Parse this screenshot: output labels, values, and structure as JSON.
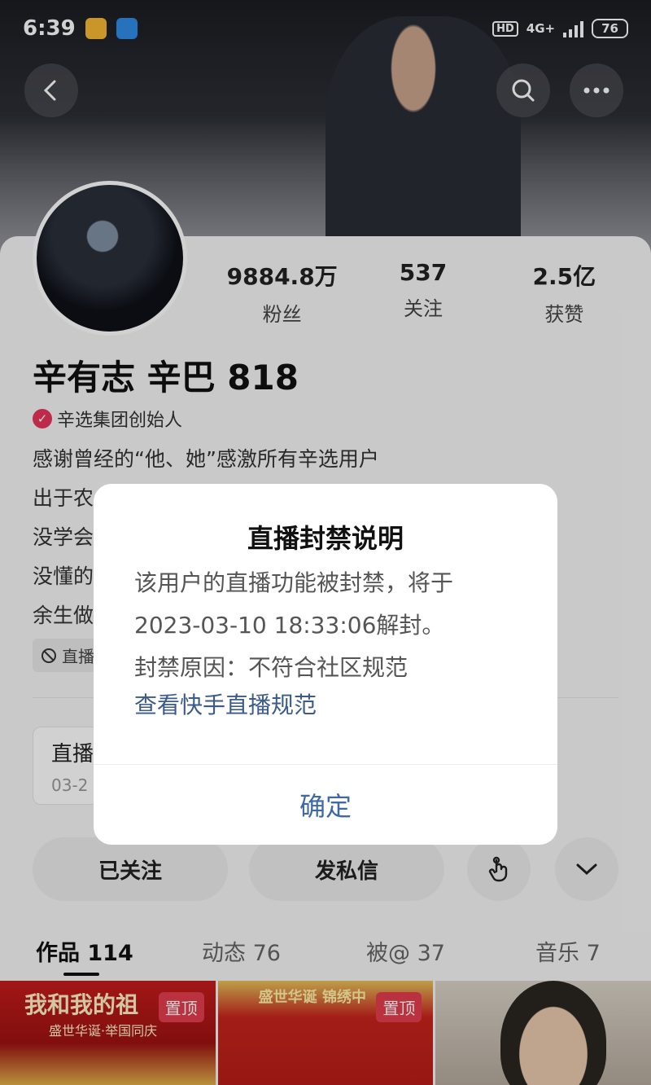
{
  "status_bar": {
    "time": "6:39",
    "hd": "HD",
    "network": "4G+",
    "battery": "76"
  },
  "profile": {
    "name": "辛有志 辛巴 818",
    "verified_title": "辛选集团创始人",
    "bio_lines": [
      "感谢曾经的“他、她”感激所有辛选用户",
      "出于农",
      "没学会",
      "没懂的",
      "余生做"
    ],
    "ban_tag": "直播",
    "stats": [
      {
        "value": "9884.8万",
        "label": "粉丝"
      },
      {
        "value": "537",
        "label": "关注"
      },
      {
        "value": "2.5亿",
        "label": "获赞"
      }
    ]
  },
  "live_card": {
    "title": "直播",
    "date": "03-2"
  },
  "actions": {
    "following": "已关注",
    "message": "发私信"
  },
  "tabs": [
    {
      "label": "作品 114",
      "active": true
    },
    {
      "label": "动态 76",
      "active": false
    },
    {
      "label": "被@ 37",
      "active": false
    },
    {
      "label": "音乐 7",
      "active": false
    }
  ],
  "grid": {
    "cell1_text": "我和我的祖",
    "cell1_sub": "盛世华诞·举国同庆",
    "cell2_text": "盛世华诞  锦绣中",
    "pin_label": "置顶"
  },
  "modal": {
    "title": "直播封禁说明",
    "line1": "该用户的直播功能被封禁，将于",
    "line2": "2023-03-10 18:33:06解封。",
    "line3": "封禁原因：不符合社区规范",
    "link": "查看快手直播规范",
    "confirm": "确定"
  },
  "colors": {
    "verified": "#e8345a",
    "link": "#3b5b8c",
    "confirm": "#3d6aa6",
    "pin": "#e33d4f"
  }
}
